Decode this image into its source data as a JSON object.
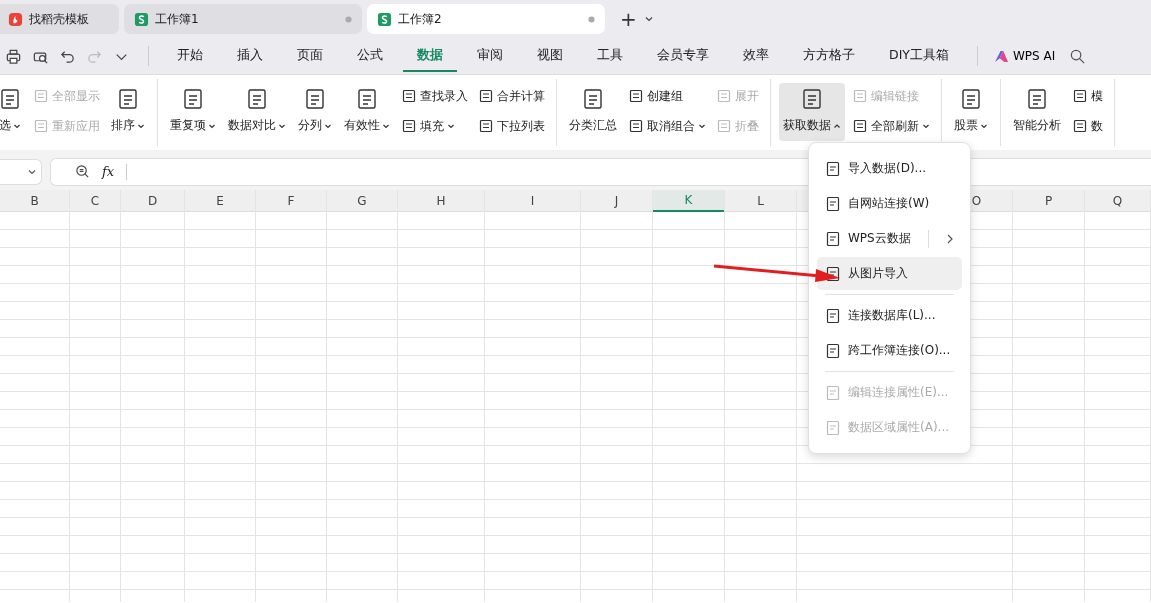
{
  "title_tabs": [
    {
      "label": "找稻壳模板",
      "kind": "template",
      "selected": false,
      "dot": false
    },
    {
      "label": "工作簿1",
      "kind": "sheet",
      "selected": false,
      "dot": true
    },
    {
      "label": "工作簿2",
      "kind": "sheet",
      "selected": true,
      "dot": true
    }
  ],
  "new_tab": "+",
  "menu_tabs": [
    {
      "label": "开始",
      "selected": false
    },
    {
      "label": "插入",
      "selected": false
    },
    {
      "label": "页面",
      "selected": false
    },
    {
      "label": "公式",
      "selected": false
    },
    {
      "label": "数据",
      "selected": true
    },
    {
      "label": "审阅",
      "selected": false
    },
    {
      "label": "视图",
      "selected": false
    },
    {
      "label": "工具",
      "selected": false
    },
    {
      "label": "会员专享",
      "selected": false
    },
    {
      "label": "效率",
      "selected": false
    },
    {
      "label": "方方格子",
      "selected": false
    },
    {
      "label": "DIY工具箱",
      "selected": false
    }
  ],
  "ai_button": "WPS AI",
  "ribbon": [
    {
      "columns": [
        {
          "kind": "large",
          "label": "选",
          "dropdown": true,
          "disabled": false,
          "pressed": false
        },
        {
          "kind": "stack",
          "items": [
            {
              "label": "全部显示",
              "dropdown": false,
              "disabled": true
            },
            {
              "label": "重新应用",
              "dropdown": false,
              "disabled": true
            }
          ]
        },
        {
          "kind": "large",
          "label": "排序",
          "dropdown": true,
          "disabled": false,
          "pressed": false
        }
      ]
    },
    {
      "columns": [
        {
          "kind": "large",
          "label": "重复项",
          "dropdown": true,
          "disabled": false,
          "pressed": false
        },
        {
          "kind": "large",
          "label": "数据对比",
          "dropdown": true,
          "disabled": false,
          "pressed": false
        },
        {
          "kind": "large",
          "label": "分列",
          "dropdown": true,
          "disabled": false,
          "pressed": false
        },
        {
          "kind": "large",
          "label": "有效性",
          "dropdown": true,
          "disabled": false,
          "pressed": false
        },
        {
          "kind": "stack",
          "items": [
            {
              "label": "查找录入",
              "dropdown": false,
              "disabled": false
            },
            {
              "label": "填充",
              "dropdown": true,
              "disabled": false
            }
          ]
        },
        {
          "kind": "stack",
          "items": [
            {
              "label": "合并计算",
              "dropdown": false,
              "disabled": false
            },
            {
              "label": "下拉列表",
              "dropdown": false,
              "disabled": false
            }
          ]
        }
      ]
    },
    {
      "columns": [
        {
          "kind": "large",
          "label": "分类汇总",
          "dropdown": false,
          "disabled": false,
          "pressed": false
        },
        {
          "kind": "stack",
          "items": [
            {
              "label": "创建组",
              "dropdown": false,
              "disabled": false
            },
            {
              "label": "取消组合",
              "dropdown": true,
              "disabled": false
            }
          ]
        },
        {
          "kind": "stack",
          "items": [
            {
              "label": "展开",
              "dropdown": false,
              "disabled": true
            },
            {
              "label": "折叠",
              "dropdown": false,
              "disabled": true
            }
          ]
        }
      ]
    },
    {
      "columns": [
        {
          "kind": "large",
          "label": "获取数据",
          "dropdown": true,
          "disabled": false,
          "pressed": true
        },
        {
          "kind": "stack",
          "items": [
            {
              "label": "编辑链接",
              "dropdown": false,
              "disabled": true
            },
            {
              "label": "全部刷新",
              "dropdown": true,
              "disabled": false
            }
          ]
        }
      ]
    },
    {
      "columns": [
        {
          "kind": "large",
          "label": "股票",
          "dropdown": true,
          "disabled": false,
          "pressed": false
        }
      ]
    },
    {
      "columns": [
        {
          "kind": "large",
          "label": "智能分析",
          "dropdown": false,
          "disabled": false,
          "pressed": false
        },
        {
          "kind": "stack",
          "items": [
            {
              "label": "模",
              "dropdown": false,
              "disabled": false
            },
            {
              "label": "数",
              "dropdown": false,
              "disabled": false
            }
          ]
        }
      ]
    }
  ],
  "formula_bar": {
    "fx": "fx"
  },
  "columns": [
    {
      "label": "B",
      "selected": false
    },
    {
      "label": "C",
      "selected": false
    },
    {
      "label": "D",
      "selected": false
    },
    {
      "label": "E",
      "selected": false
    },
    {
      "label": "F",
      "selected": false
    },
    {
      "label": "G",
      "selected": false
    },
    {
      "label": "H",
      "selected": false
    },
    {
      "label": "I",
      "selected": false
    },
    {
      "label": "J",
      "selected": false
    },
    {
      "label": "K",
      "selected": true
    },
    {
      "label": "L",
      "selected": false
    },
    {
      "label": "O",
      "selected": false
    },
    {
      "label": "P",
      "selected": false
    },
    {
      "label": "Q",
      "selected": false
    }
  ],
  "dropdown_menu": [
    {
      "kind": "item",
      "label": "导入数据(D)...",
      "disabled": false,
      "selected": false,
      "submenu": false
    },
    {
      "kind": "item",
      "label": "自网站连接(W)",
      "disabled": false,
      "selected": false,
      "submenu": false
    },
    {
      "kind": "item",
      "label": "WPS云数据",
      "disabled": false,
      "selected": false,
      "submenu": true
    },
    {
      "kind": "item",
      "label": "从图片导入",
      "disabled": false,
      "selected": true,
      "submenu": false
    },
    {
      "kind": "separator"
    },
    {
      "kind": "item",
      "label": "连接数据库(L)...",
      "disabled": false,
      "selected": false,
      "submenu": false
    },
    {
      "kind": "item",
      "label": "跨工作簿连接(O)...",
      "disabled": false,
      "selected": false,
      "submenu": false
    },
    {
      "kind": "separator"
    },
    {
      "kind": "item",
      "label": "编辑连接属性(E)...",
      "disabled": true,
      "selected": false,
      "submenu": false
    },
    {
      "kind": "item",
      "label": "数据区域属性(A)...",
      "disabled": true,
      "selected": false,
      "submenu": false
    }
  ]
}
